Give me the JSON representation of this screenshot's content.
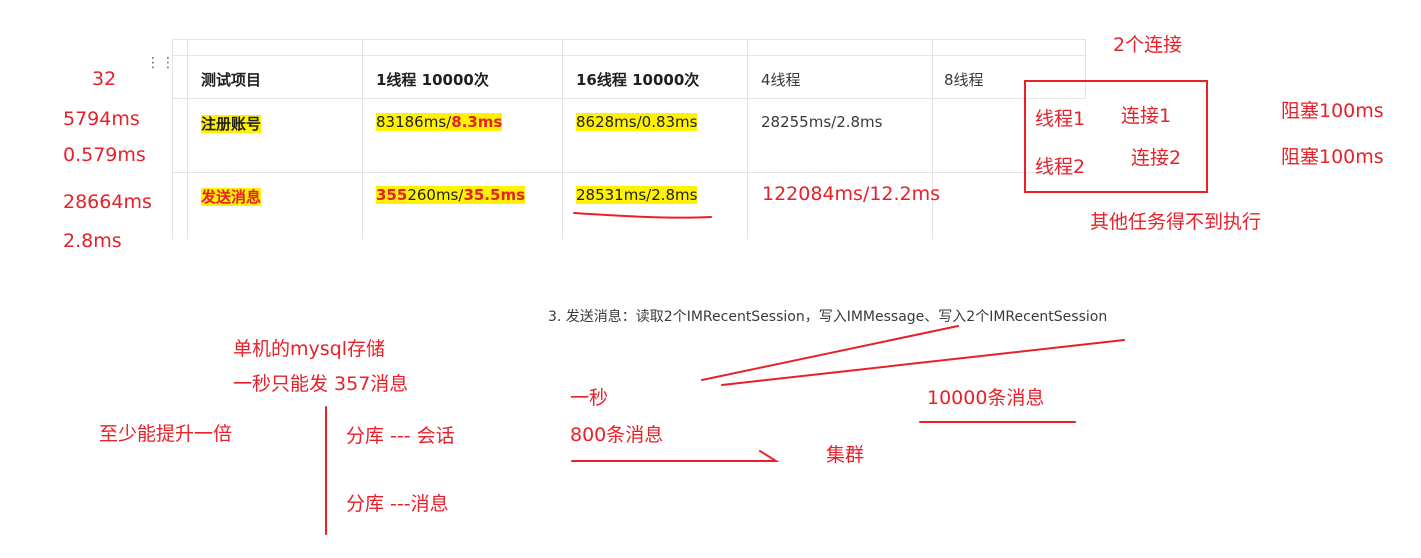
{
  "left_notes": {
    "n32": "32",
    "n5794": "5794ms",
    "n0579": "0.579ms",
    "n28664": "28664ms",
    "n28": "2.8ms"
  },
  "table": {
    "headers": [
      "测试项目",
      "1线程 10000次",
      "16线程 10000次",
      "4线程",
      "8线程"
    ],
    "row1": {
      "label": "注册账号",
      "c1_a": "83186ms/",
      "c1_b": "8.3ms",
      "c2": "8628ms/0.83ms",
      "c3": "28255ms/2.8ms"
    },
    "row2": {
      "label": "发送消息",
      "c1_a": "355",
      "c1_b": "260ms/",
      "c1_c": "35.5ms",
      "c2": "28531ms/2.8ms",
      "c3": "122084ms/12.2ms"
    }
  },
  "right_notes": {
    "two_conn": "2个连接",
    "thread1": "线程1",
    "conn1": "连接1",
    "thread2": "线程2",
    "conn2": "连接2",
    "block1": "阻塞100ms",
    "block2": "阻塞100ms",
    "others": "其他任务得不到执行"
  },
  "doc_line": "3. 发送消息：读取2个IMRecentSession，写入IMMessage、写入2个IMRecentSession",
  "bottom_notes": {
    "mysql": "单机的mysql存储",
    "per_sec_357": "一秒只能发 357消息",
    "double": "至少能提升一倍",
    "shard_session": "分库   --- 会话",
    "shard_msg": "分库   ---消息",
    "one_sec": "一秒",
    "msg800": "800条消息",
    "msg10000": "10000条消息",
    "cluster": "集群"
  },
  "colors": {
    "annotation_red": "#e8202a",
    "highlight_yellow": "#fff200"
  }
}
